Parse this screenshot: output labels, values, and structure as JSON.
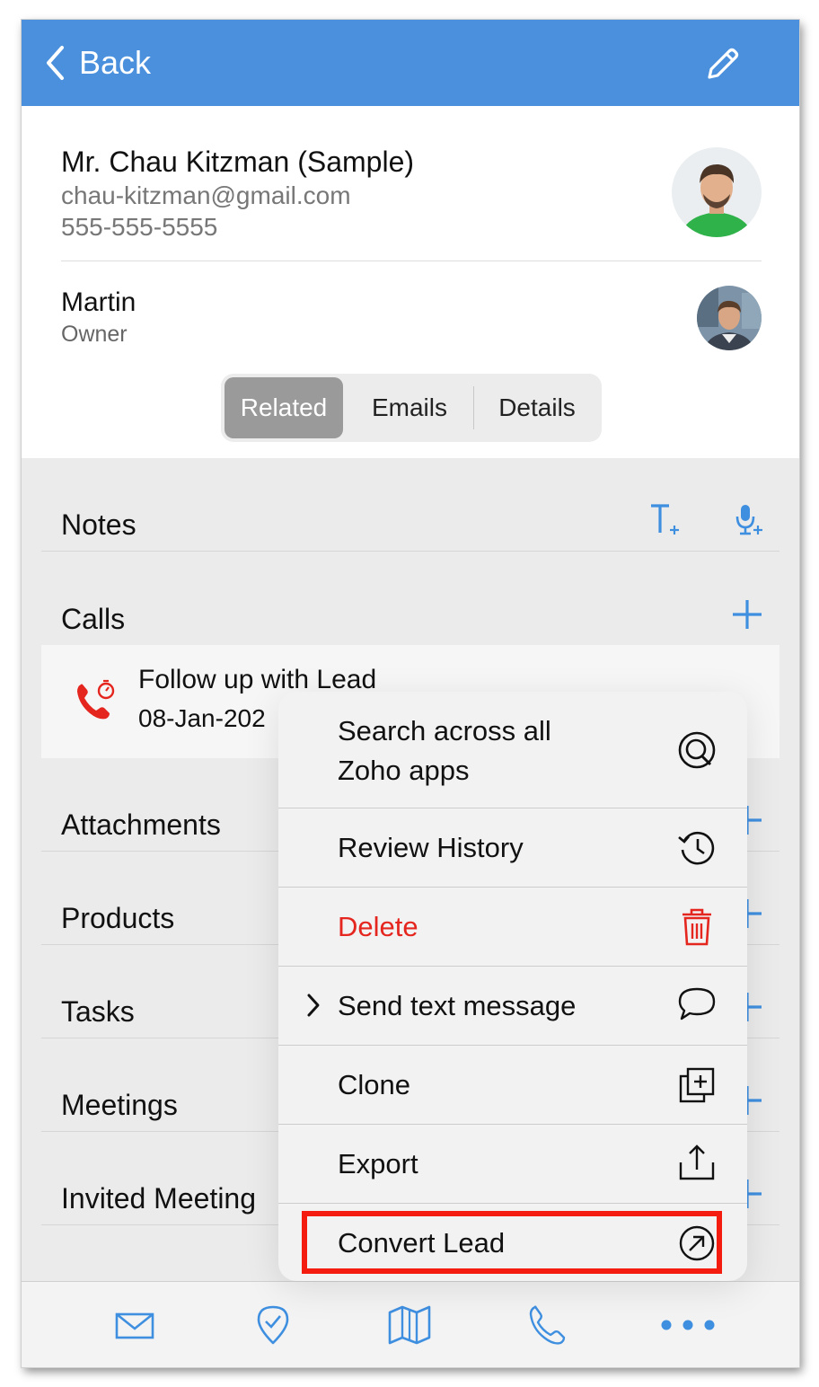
{
  "header": {
    "back_label": "Back",
    "back_icon": "chevron-left-icon",
    "edit_icon": "pencil-icon",
    "color": "#4a90dd"
  },
  "lead": {
    "name": "Mr. Chau Kitzman (Sample)",
    "email": "chau-kitzman@gmail.com",
    "phone": "555-555-5555",
    "avatar_icon": "lead-avatar"
  },
  "owner": {
    "name": "Martin",
    "role": "Owner",
    "avatar_icon": "owner-avatar"
  },
  "segments": {
    "items": [
      "Related",
      "Emails",
      "Details"
    ],
    "selected": "Related"
  },
  "sections": {
    "notes": {
      "title": "Notes",
      "icons": [
        "add-text-note-icon",
        "add-voice-note-icon"
      ]
    },
    "calls": {
      "title": "Calls"
    },
    "attachments": {
      "title": "Attachments"
    },
    "products": {
      "title": "Products"
    },
    "tasks": {
      "title": "Tasks"
    },
    "meetings": {
      "title": "Meetings"
    },
    "invited": {
      "title": "Invited Meeting"
    }
  },
  "call_item": {
    "title": "Follow up with Lead",
    "date": "08-Jan-202",
    "icon": "scheduled-call-icon"
  },
  "menu": {
    "search": {
      "label_line1": "Search across all",
      "label_line2": "Zoho apps",
      "icon": "zoho-search-icon"
    },
    "history": {
      "label": "Review History",
      "icon": "history-icon"
    },
    "delete": {
      "label": "Delete",
      "icon": "trash-icon",
      "color": "#e5261f"
    },
    "sms": {
      "label": "Send text message",
      "icon": "chat-bubble-icon"
    },
    "clone": {
      "label": "Clone",
      "icon": "clone-icon"
    },
    "export": {
      "label": "Export",
      "icon": "share-upload-icon"
    },
    "convert": {
      "label": "Convert Lead",
      "icon": "convert-arrow-icon",
      "highlight_color": "#f41b0f"
    }
  },
  "bottom_bar": {
    "icons": [
      "mail-icon",
      "checkin-icon",
      "map-icon",
      "phone-icon",
      "more-icon"
    ]
  }
}
